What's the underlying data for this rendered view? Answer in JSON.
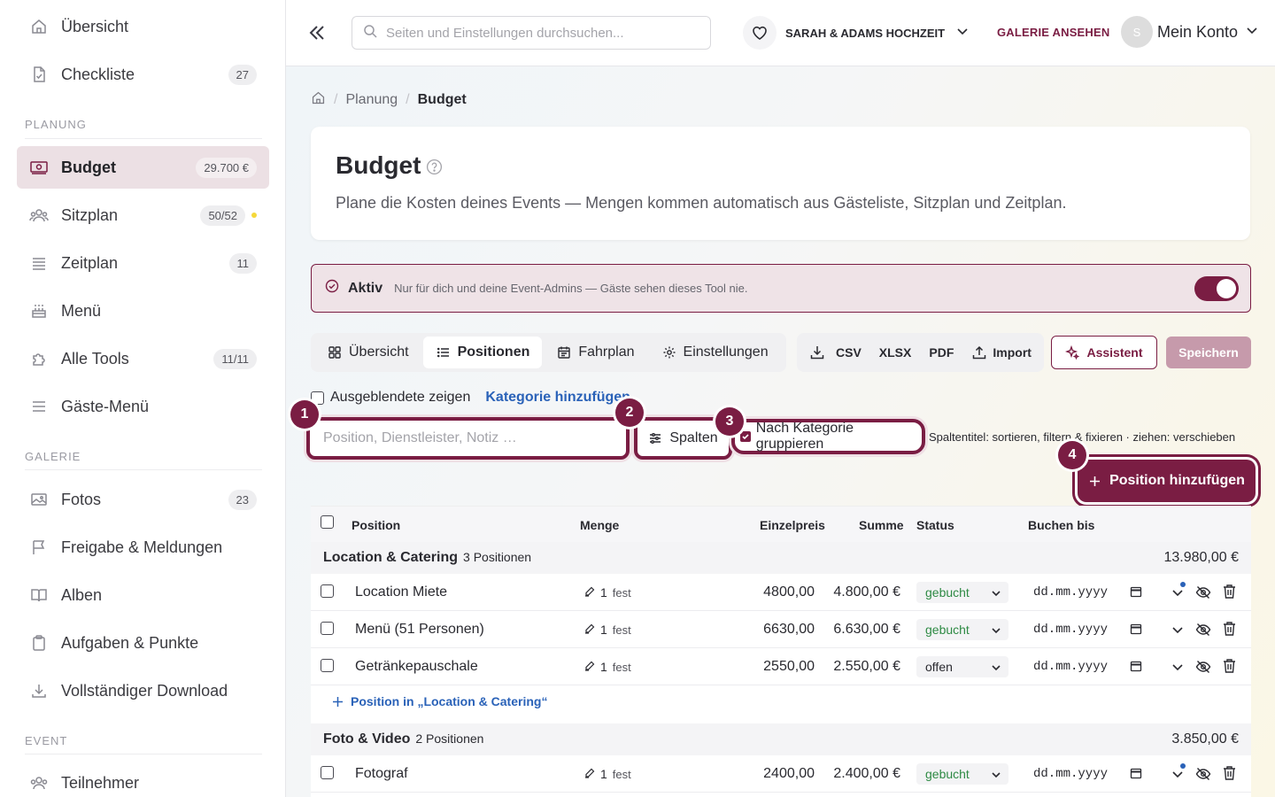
{
  "sidebar": {
    "items": [
      {
        "label": "Übersicht",
        "badge": ""
      },
      {
        "label": "Checkliste",
        "badge": "27"
      },
      {
        "label": "Budget",
        "badge": "29.700 €"
      },
      {
        "label": "Sitzplan",
        "badge": "50/52"
      },
      {
        "label": "Zeitplan",
        "badge": "11"
      },
      {
        "label": "Menü",
        "badge": ""
      },
      {
        "label": "Alle Tools",
        "badge": "11/11"
      },
      {
        "label": "Gäste-Menü",
        "badge": ""
      },
      {
        "label": "Fotos",
        "badge": "23"
      },
      {
        "label": "Freigabe & Meldungen",
        "badge": ""
      },
      {
        "label": "Alben",
        "badge": ""
      },
      {
        "label": "Aufgaben & Punkte",
        "badge": ""
      },
      {
        "label": "Vollständiger Download",
        "badge": ""
      },
      {
        "label": "Teilnehmer",
        "badge": ""
      }
    ],
    "sections": {
      "planung": "PLANUNG",
      "galerie": "GALERIE",
      "event": "EVENT"
    }
  },
  "header": {
    "search_placeholder": "Seiten und Einstellungen durchsuchen...",
    "event_name": "SARAH & ADAMS HOCHZEIT",
    "gallery_link": "GALERIE ANSEHEN",
    "avatar_initial": "S",
    "account_label": "Mein Konto"
  },
  "breadcrumb": {
    "planung": "Planung",
    "current": "Budget"
  },
  "page": {
    "title": "Budget",
    "description": "Plane die Kosten deines Events — Mengen kommen automatisch aus Gästeliste, Sitzplan und Zeitplan."
  },
  "active_bar": {
    "label": "Aktiv",
    "info": "Nur für dich und deine Event-Admins — Gäste sehen dieses Tool nie.",
    "enabled": true
  },
  "tabs": [
    {
      "label": "Übersicht"
    },
    {
      "label": "Positionen"
    },
    {
      "label": "Fahrplan"
    },
    {
      "label": "Einstellungen"
    }
  ],
  "exports": {
    "csv": "CSV",
    "xlsx": "XLSX",
    "pdf": "PDF",
    "import": "Import"
  },
  "buttons": {
    "assistant": "Assistent",
    "save": "Speichern",
    "columns": "Spalten",
    "add_position": "Position hinzufügen"
  },
  "filters": {
    "show_hidden": "Ausgeblendete zeigen",
    "add_category": "Kategorie hinzufügen",
    "filter_placeholder": "Position, Dienstleister, Notiz …",
    "group_by_category": "Nach Kategorie gruppieren",
    "column_hint": "Spaltentitel: sortieren, filtern & fixieren · ziehen: verschieben"
  },
  "steps": [
    "1",
    "2",
    "3",
    "4"
  ],
  "table": {
    "headers": {
      "position": "Position",
      "menge": "Menge",
      "einzelpreis": "Einzelpreis",
      "summe": "Summe",
      "status": "Status",
      "buchen_bis": "Buchen bis"
    },
    "groups": [
      {
        "name": "Location & Catering",
        "count": "3 Positionen",
        "sum": "13.980,00 €",
        "add_label": "Position in „Location & Catering“",
        "rows": [
          {
            "name": "Location Miete",
            "qty": "1",
            "qty_type": "fest",
            "price": "4800,00",
            "sum": "4.800,00 €",
            "status": "gebucht",
            "date": "dd.mm.yyyy"
          },
          {
            "name": "Menü (51 Personen)",
            "qty": "1",
            "qty_type": "fest",
            "price": "6630,00",
            "sum": "6.630,00 €",
            "status": "gebucht",
            "date": "dd.mm.yyyy"
          },
          {
            "name": "Getränkepauschale",
            "qty": "1",
            "qty_type": "fest",
            "price": "2550,00",
            "sum": "2.550,00 €",
            "status": "offen",
            "date": "dd.mm.yyyy"
          }
        ]
      },
      {
        "name": "Foto & Video",
        "count": "2 Positionen",
        "sum": "3.850,00 €",
        "rows": [
          {
            "name": "Fotograf",
            "qty": "1",
            "qty_type": "fest",
            "price": "2400,00",
            "sum": "2.400,00 €",
            "status": "gebucht",
            "date": "dd.mm.yyyy"
          }
        ]
      }
    ]
  },
  "colors": {
    "accent": "#7a1d43",
    "link": "#2a62b8",
    "booked": "#2e8a44"
  }
}
